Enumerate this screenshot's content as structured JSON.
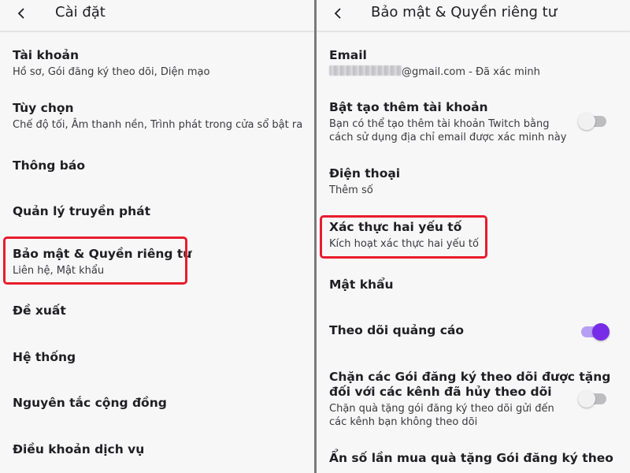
{
  "left": {
    "title": "Cài đặt",
    "items": [
      {
        "title": "Tài khoản",
        "sub": "Hồ sơ, Gói đăng ký theo dõi, Diện mạo"
      },
      {
        "title": "Tùy chọn",
        "sub": "Chế độ tối, Âm thanh nền, Trình phát trong cửa sổ bật ra"
      },
      {
        "title": "Thông báo"
      },
      {
        "title": "Quản lý truyền phát"
      },
      {
        "title": "Bảo mật & Quyền riêng tư",
        "sub": "Liên hệ, Mật khẩu"
      },
      {
        "title": "Đề xuất"
      },
      {
        "title": "Hệ thống"
      },
      {
        "title": "Nguyên tắc cộng đồng"
      },
      {
        "title": "Điều khoản dịch vụ"
      }
    ]
  },
  "right": {
    "title": "Bảo mật & Quyền riêng tư",
    "email": {
      "title": "Email",
      "domain": "@gmail.com - Đã xác minh"
    },
    "extra_accounts": {
      "title": "Bật tạo thêm tài khoản",
      "sub1": "Bạn có thể tạo thêm tài khoản Twitch bằng",
      "sub2": "cách sử dụng địa chỉ email được xác minh này",
      "enabled": false
    },
    "phone": {
      "title": "Điện thoại",
      "sub": "Thêm số"
    },
    "two_factor": {
      "title": "Xác thực hai yếu tố",
      "sub": "Kích hoạt xác thực hai yếu tố"
    },
    "password": {
      "title": "Mật khẩu"
    },
    "ad_tracking": {
      "title": "Theo dõi quảng cáo",
      "enabled": true
    },
    "block_gifts": {
      "title1": "Chặn các Gói đăng ký theo dõi được tặng",
      "title2": "đối với các kênh đã hủy theo dõi",
      "sub1": "Chặn quà tặng gói đăng ký theo dõi gửi đến",
      "sub2": "các kênh bạn không theo dõi",
      "enabled": false
    },
    "hide_gift_count": {
      "title": "Ẩn số lần mua quà tặng Gói đăng ký theo"
    }
  },
  "colors": {
    "accent": "#772ce8",
    "highlight": "#e81c2c",
    "background": "#f7f7f8"
  },
  "icons": {
    "back": "chevron-left-icon"
  }
}
